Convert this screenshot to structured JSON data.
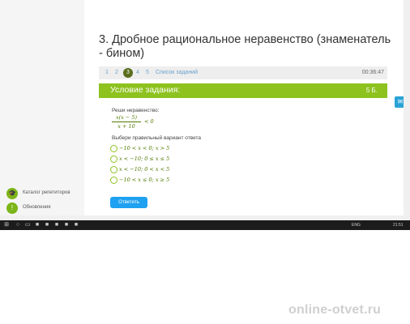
{
  "task": {
    "title_line1": "3. Дробное рациональное неравенство (знаменатель",
    "title_line2": "- бином)",
    "pages": [
      "1",
      "2",
      "3",
      "4",
      "5"
    ],
    "active_page": "3",
    "task_list_link": "Список заданий",
    "timer": "00:36:47",
    "condition_header": "Условие задания:",
    "score": "5 Б.",
    "instruction": "Реши неравенство:",
    "numerator": "x(x − 5)",
    "denominator": "x + 10",
    "comparison": "< 0",
    "choose_label": "Выбери правильный вариант ответа",
    "options": [
      "−10 < x < 0; x > 5",
      "x < −10; 0 ≤ x ≤ 5",
      "x < −10; 0 < x < 5",
      "−10 < x ≤ 0; x ≥ 5"
    ],
    "submit_label": "Ответить"
  },
  "sidebar": {
    "items": [
      {
        "label": "Каталог репетиторов",
        "icon": "graduation-cap-icon"
      },
      {
        "label": "Обновления",
        "icon": "exclamation-icon"
      }
    ]
  },
  "taskbar": {
    "lang": "ENG",
    "clock": "21:51"
  },
  "watermark": "online-otvet.ru",
  "colors": {
    "accent_green": "#8dc21f",
    "active_page": "#5a6d1c",
    "button_blue": "#1ea1f1"
  }
}
